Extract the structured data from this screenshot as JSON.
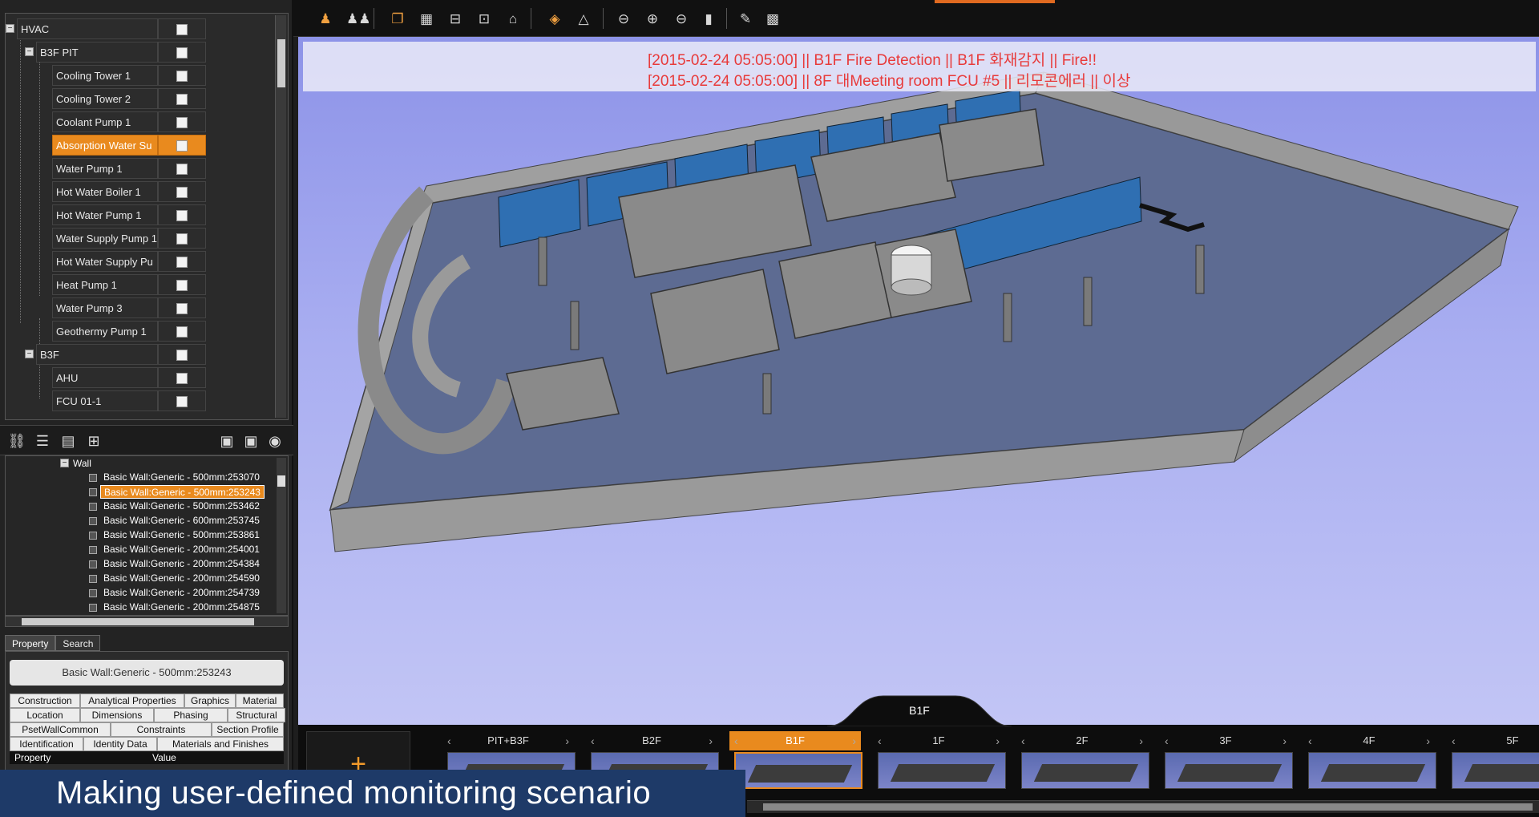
{
  "tree": {
    "rows": [
      {
        "label": "HVAC",
        "level": 0
      },
      {
        "label": "B3F PIT",
        "level": 1
      },
      {
        "label": "Cooling Tower 1",
        "level": 2
      },
      {
        "label": "Cooling Tower 2",
        "level": 2
      },
      {
        "label": "Coolant Pump 1",
        "level": 2
      },
      {
        "label": "Absorption Water Su",
        "level": 2,
        "selected": true
      },
      {
        "label": "Water Pump 1",
        "level": 2
      },
      {
        "label": "Hot Water Boiler 1",
        "level": 2
      },
      {
        "label": "Hot Water Pump 1",
        "level": 2
      },
      {
        "label": "Water Supply Pump 1",
        "level": 2
      },
      {
        "label": "Hot Water Supply Pu",
        "level": 2
      },
      {
        "label": "Heat Pump 1",
        "level": 2
      },
      {
        "label": "Water Pump 3",
        "level": 2
      },
      {
        "label": "Geothermy Pump 1",
        "level": 2
      },
      {
        "label": "B3F",
        "level": 1
      },
      {
        "label": "AHU",
        "level": 2
      },
      {
        "label": "FCU 01-1",
        "level": 2
      }
    ]
  },
  "objects": {
    "group": "Wall",
    "items": [
      "Basic Wall:Generic - 500mm:253070",
      "Basic Wall:Generic - 500mm:253243",
      "Basic Wall:Generic - 500mm:253462",
      "Basic Wall:Generic - 600mm:253745",
      "Basic Wall:Generic - 500mm:253861",
      "Basic Wall:Generic - 200mm:254001",
      "Basic Wall:Generic - 200mm:254384",
      "Basic Wall:Generic - 200mm:254590",
      "Basic Wall:Generic - 200mm:254739",
      "Basic Wall:Generic - 200mm:254875"
    ],
    "selected_index": 1
  },
  "props": {
    "tab_property": "Property",
    "tab_search": "Search",
    "name": "Basic Wall:Generic - 500mm:253243",
    "groups": [
      "Construction",
      "Analytical Properties",
      "Graphics",
      "Material",
      "Location",
      "Dimensions",
      "Phasing",
      "Structural",
      "PsetWallCommon",
      "Constraints",
      "Section Profile",
      "Identification",
      "Identity Data",
      "Materials and Finishes"
    ],
    "col_property": "Property",
    "col_value": "Value"
  },
  "alerts": [
    "[2015-02-24 05:05:00] || B1F Fire Detection || B1F 화재감지 || Fire!!",
    "[2015-02-24 05:05:00] || 8F 대Meeting room  FCU #5 || 리모콘에러 || 이상"
  ],
  "floorbar": {
    "current": "B1F",
    "add_label": "+",
    "floors": [
      "PIT+B3F",
      "B2F",
      "B1F",
      "1F",
      "2F",
      "3F",
      "4F",
      "5F"
    ],
    "selected_index": 2
  },
  "caption": "Making user-defined monitoring scenario",
  "colors": {
    "accent": "#e98a1e",
    "alert": "#e83a3a",
    "caption_bg": "#1e3a68"
  }
}
